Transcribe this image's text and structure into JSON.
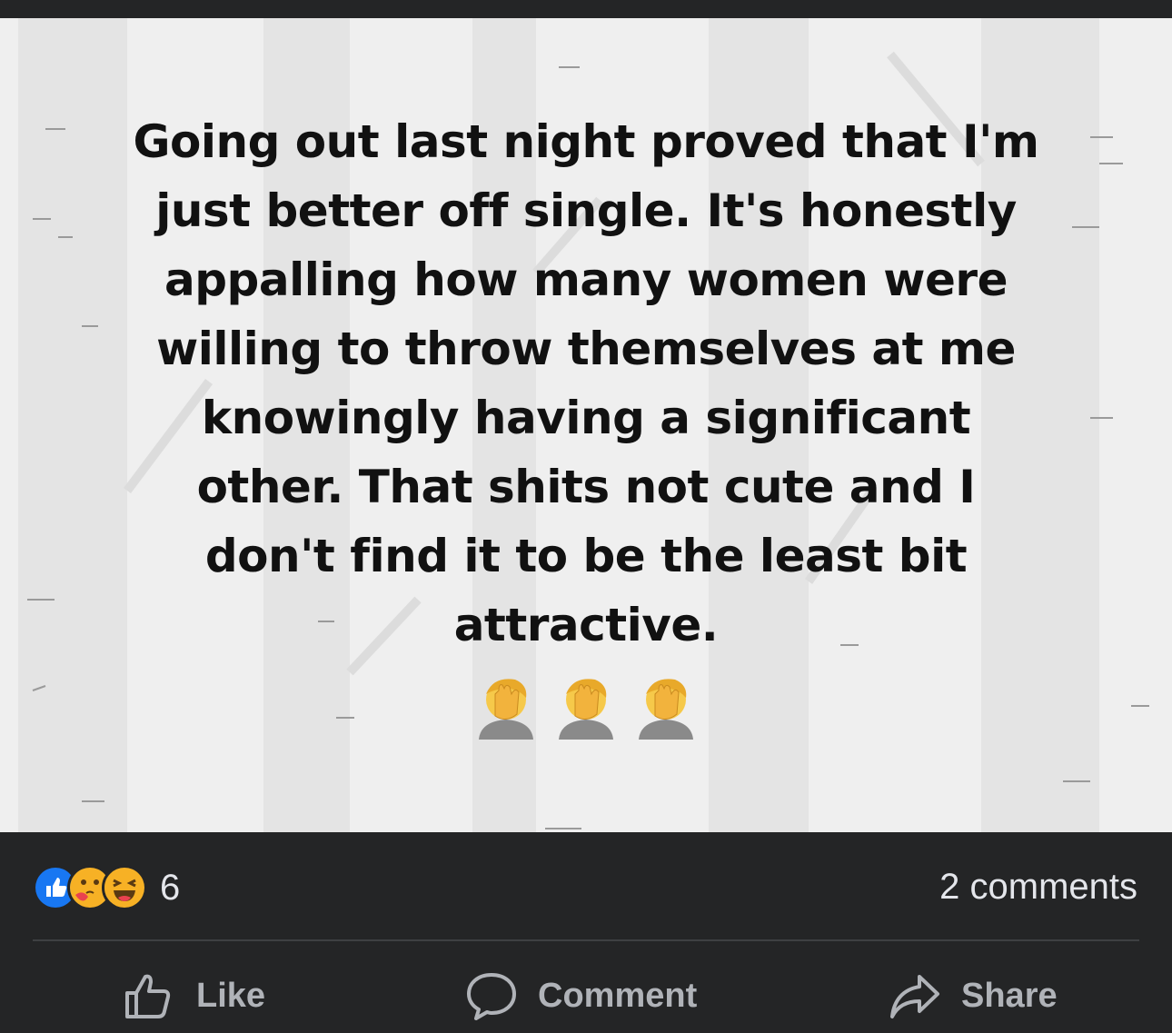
{
  "post": {
    "text_lines": [
      "Going out last night proved that I'm",
      "just better off single. It's honestly",
      "appalling how many women were",
      "willing to throw themselves at me",
      "knowingly having a significant",
      "other. That shits not cute and I",
      "don't find it to be the least bit",
      "attractive."
    ],
    "emoji": [
      "facepalm-emoji",
      "facepalm-emoji",
      "facepalm-emoji"
    ],
    "background_color": "#f0f0f0",
    "text_color": "#111111"
  },
  "footer": {
    "reactions": [
      "like-icon",
      "care-icon",
      "haha-icon"
    ],
    "reaction_count": "6",
    "comments_label": "2 comments",
    "actions": {
      "like_label": "Like",
      "comment_label": "Comment",
      "share_label": "Share"
    },
    "background_color": "#242526",
    "text_color": "#e4e6eb",
    "action_color": "#b0b3b8",
    "like_color": "#1877f2"
  }
}
